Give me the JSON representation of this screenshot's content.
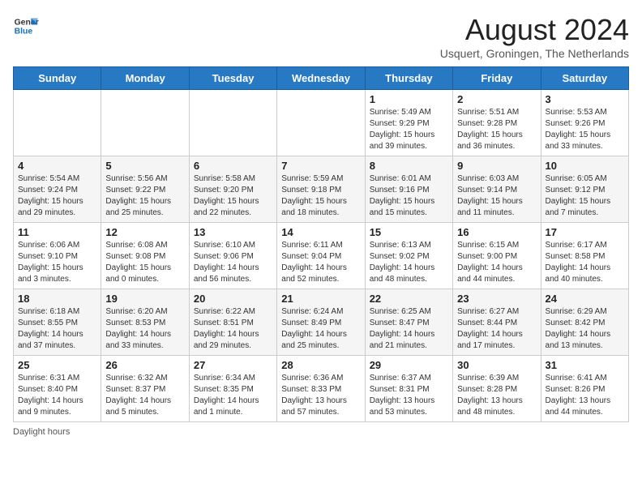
{
  "logo": {
    "line1": "General",
    "line2": "Blue"
  },
  "title": "August 2024",
  "location": "Usquert, Groningen, The Netherlands",
  "weekdays": [
    "Sunday",
    "Monday",
    "Tuesday",
    "Wednesday",
    "Thursday",
    "Friday",
    "Saturday"
  ],
  "weeks": [
    [
      {
        "day": "",
        "info": ""
      },
      {
        "day": "",
        "info": ""
      },
      {
        "day": "",
        "info": ""
      },
      {
        "day": "",
        "info": ""
      },
      {
        "day": "1",
        "info": "Sunrise: 5:49 AM\nSunset: 9:29 PM\nDaylight: 15 hours and 39 minutes."
      },
      {
        "day": "2",
        "info": "Sunrise: 5:51 AM\nSunset: 9:28 PM\nDaylight: 15 hours and 36 minutes."
      },
      {
        "day": "3",
        "info": "Sunrise: 5:53 AM\nSunset: 9:26 PM\nDaylight: 15 hours and 33 minutes."
      }
    ],
    [
      {
        "day": "4",
        "info": "Sunrise: 5:54 AM\nSunset: 9:24 PM\nDaylight: 15 hours and 29 minutes."
      },
      {
        "day": "5",
        "info": "Sunrise: 5:56 AM\nSunset: 9:22 PM\nDaylight: 15 hours and 25 minutes."
      },
      {
        "day": "6",
        "info": "Sunrise: 5:58 AM\nSunset: 9:20 PM\nDaylight: 15 hours and 22 minutes."
      },
      {
        "day": "7",
        "info": "Sunrise: 5:59 AM\nSunset: 9:18 PM\nDaylight: 15 hours and 18 minutes."
      },
      {
        "day": "8",
        "info": "Sunrise: 6:01 AM\nSunset: 9:16 PM\nDaylight: 15 hours and 15 minutes."
      },
      {
        "day": "9",
        "info": "Sunrise: 6:03 AM\nSunset: 9:14 PM\nDaylight: 15 hours and 11 minutes."
      },
      {
        "day": "10",
        "info": "Sunrise: 6:05 AM\nSunset: 9:12 PM\nDaylight: 15 hours and 7 minutes."
      }
    ],
    [
      {
        "day": "11",
        "info": "Sunrise: 6:06 AM\nSunset: 9:10 PM\nDaylight: 15 hours and 3 minutes."
      },
      {
        "day": "12",
        "info": "Sunrise: 6:08 AM\nSunset: 9:08 PM\nDaylight: 15 hours and 0 minutes."
      },
      {
        "day": "13",
        "info": "Sunrise: 6:10 AM\nSunset: 9:06 PM\nDaylight: 14 hours and 56 minutes."
      },
      {
        "day": "14",
        "info": "Sunrise: 6:11 AM\nSunset: 9:04 PM\nDaylight: 14 hours and 52 minutes."
      },
      {
        "day": "15",
        "info": "Sunrise: 6:13 AM\nSunset: 9:02 PM\nDaylight: 14 hours and 48 minutes."
      },
      {
        "day": "16",
        "info": "Sunrise: 6:15 AM\nSunset: 9:00 PM\nDaylight: 14 hours and 44 minutes."
      },
      {
        "day": "17",
        "info": "Sunrise: 6:17 AM\nSunset: 8:58 PM\nDaylight: 14 hours and 40 minutes."
      }
    ],
    [
      {
        "day": "18",
        "info": "Sunrise: 6:18 AM\nSunset: 8:55 PM\nDaylight: 14 hours and 37 minutes."
      },
      {
        "day": "19",
        "info": "Sunrise: 6:20 AM\nSunset: 8:53 PM\nDaylight: 14 hours and 33 minutes."
      },
      {
        "day": "20",
        "info": "Sunrise: 6:22 AM\nSunset: 8:51 PM\nDaylight: 14 hours and 29 minutes."
      },
      {
        "day": "21",
        "info": "Sunrise: 6:24 AM\nSunset: 8:49 PM\nDaylight: 14 hours and 25 minutes."
      },
      {
        "day": "22",
        "info": "Sunrise: 6:25 AM\nSunset: 8:47 PM\nDaylight: 14 hours and 21 minutes."
      },
      {
        "day": "23",
        "info": "Sunrise: 6:27 AM\nSunset: 8:44 PM\nDaylight: 14 hours and 17 minutes."
      },
      {
        "day": "24",
        "info": "Sunrise: 6:29 AM\nSunset: 8:42 PM\nDaylight: 14 hours and 13 minutes."
      }
    ],
    [
      {
        "day": "25",
        "info": "Sunrise: 6:31 AM\nSunset: 8:40 PM\nDaylight: 14 hours and 9 minutes."
      },
      {
        "day": "26",
        "info": "Sunrise: 6:32 AM\nSunset: 8:37 PM\nDaylight: 14 hours and 5 minutes."
      },
      {
        "day": "27",
        "info": "Sunrise: 6:34 AM\nSunset: 8:35 PM\nDaylight: 14 hours and 1 minute."
      },
      {
        "day": "28",
        "info": "Sunrise: 6:36 AM\nSunset: 8:33 PM\nDaylight: 13 hours and 57 minutes."
      },
      {
        "day": "29",
        "info": "Sunrise: 6:37 AM\nSunset: 8:31 PM\nDaylight: 13 hours and 53 minutes."
      },
      {
        "day": "30",
        "info": "Sunrise: 6:39 AM\nSunset: 8:28 PM\nDaylight: 13 hours and 48 minutes."
      },
      {
        "day": "31",
        "info": "Sunrise: 6:41 AM\nSunset: 8:26 PM\nDaylight: 13 hours and 44 minutes."
      }
    ]
  ],
  "footer": "Daylight hours"
}
